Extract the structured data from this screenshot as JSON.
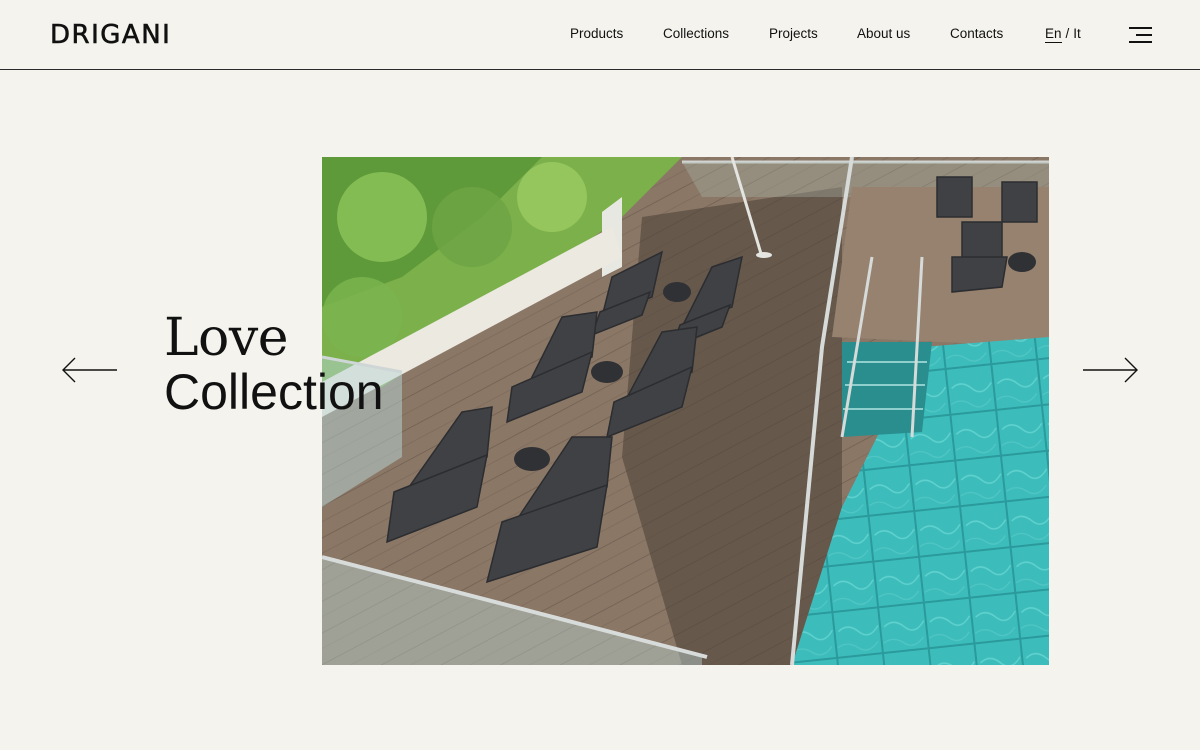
{
  "brand": {
    "logo_text": "DRIGANI"
  },
  "nav": {
    "items": [
      {
        "label": "Products"
      },
      {
        "label": "Collections"
      },
      {
        "label": "Projects"
      },
      {
        "label": "About us"
      },
      {
        "label": "Contacts"
      }
    ],
    "language": {
      "active": "En",
      "separator": "/",
      "other": "It"
    },
    "menu_icon": "hamburger-menu-icon"
  },
  "hero": {
    "title_line1": "Love",
    "title_line2": "Collection",
    "image_subject": "rooftop-pool-terrace-with-sun-loungers",
    "prev_icon": "arrow-left-icon",
    "next_icon": "arrow-right-icon"
  },
  "colors": {
    "background": "#f4f3ed",
    "text": "#111111",
    "pool": "#3fbfbf",
    "deck": "#8a7664"
  }
}
